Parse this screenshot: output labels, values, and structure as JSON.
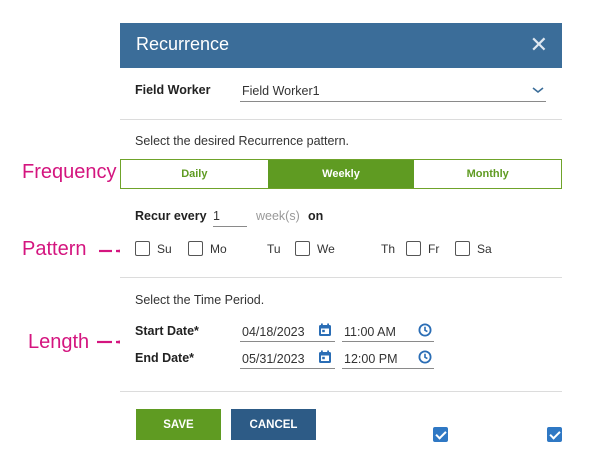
{
  "dialog": {
    "title": "Recurrence",
    "close_glyph": "✕"
  },
  "field_worker": {
    "label": "Field Worker",
    "value": "Field Worker1"
  },
  "pattern_prompt": "Select the desired Recurrence pattern.",
  "frequency_tabs": [
    {
      "label": "Daily",
      "selected": false
    },
    {
      "label": "Weekly",
      "selected": true
    },
    {
      "label": "Monthly",
      "selected": false
    }
  ],
  "recur": {
    "label": "Recur every",
    "value": "1",
    "unit": "week(s)",
    "suffix": "on"
  },
  "days": [
    {
      "label": "Su",
      "checked": false
    },
    {
      "label": "Mo",
      "checked": false
    },
    {
      "label": "Tu",
      "checked": true
    },
    {
      "label": "We",
      "checked": false
    },
    {
      "label": "Th",
      "checked": true
    },
    {
      "label": "Fr",
      "checked": false
    },
    {
      "label": "Sa",
      "checked": false
    }
  ],
  "period_prompt": "Select the Time Period.",
  "start": {
    "label": "Start Date*",
    "date": "04/18/2023",
    "time": "11:00 AM"
  },
  "end": {
    "label": "End Date*",
    "date": "05/31/2023",
    "time": "12:00 PM"
  },
  "buttons": {
    "save": "SAVE",
    "cancel": "CANCEL"
  },
  "annotations": {
    "frequency": "Frequency",
    "pattern": "Pattern",
    "length": "Length"
  },
  "colors": {
    "header": "#3b6d99",
    "green": "#5f9b22",
    "blue_icon": "#2a6db5",
    "annotation": "#d4157f"
  }
}
